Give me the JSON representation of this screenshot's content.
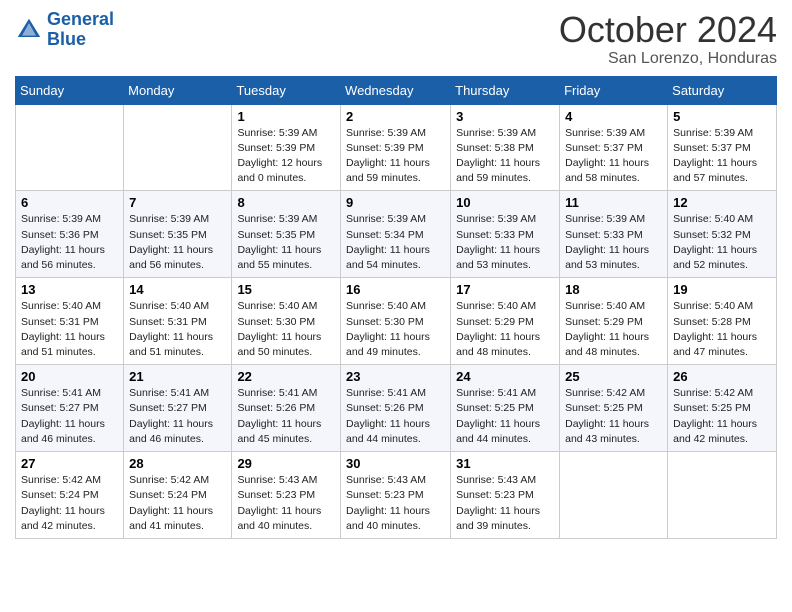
{
  "logo": {
    "line1": "General",
    "line2": "Blue"
  },
  "title": "October 2024",
  "subtitle": "San Lorenzo, Honduras",
  "days_of_week": [
    "Sunday",
    "Monday",
    "Tuesday",
    "Wednesday",
    "Thursday",
    "Friday",
    "Saturday"
  ],
  "weeks": [
    [
      {
        "day": "",
        "sunrise": "",
        "sunset": "",
        "daylight": ""
      },
      {
        "day": "",
        "sunrise": "",
        "sunset": "",
        "daylight": ""
      },
      {
        "day": "1",
        "sunrise": "Sunrise: 5:39 AM",
        "sunset": "Sunset: 5:39 PM",
        "daylight": "Daylight: 12 hours and 0 minutes."
      },
      {
        "day": "2",
        "sunrise": "Sunrise: 5:39 AM",
        "sunset": "Sunset: 5:39 PM",
        "daylight": "Daylight: 11 hours and 59 minutes."
      },
      {
        "day": "3",
        "sunrise": "Sunrise: 5:39 AM",
        "sunset": "Sunset: 5:38 PM",
        "daylight": "Daylight: 11 hours and 59 minutes."
      },
      {
        "day": "4",
        "sunrise": "Sunrise: 5:39 AM",
        "sunset": "Sunset: 5:37 PM",
        "daylight": "Daylight: 11 hours and 58 minutes."
      },
      {
        "day": "5",
        "sunrise": "Sunrise: 5:39 AM",
        "sunset": "Sunset: 5:37 PM",
        "daylight": "Daylight: 11 hours and 57 minutes."
      }
    ],
    [
      {
        "day": "6",
        "sunrise": "Sunrise: 5:39 AM",
        "sunset": "Sunset: 5:36 PM",
        "daylight": "Daylight: 11 hours and 56 minutes."
      },
      {
        "day": "7",
        "sunrise": "Sunrise: 5:39 AM",
        "sunset": "Sunset: 5:35 PM",
        "daylight": "Daylight: 11 hours and 56 minutes."
      },
      {
        "day": "8",
        "sunrise": "Sunrise: 5:39 AM",
        "sunset": "Sunset: 5:35 PM",
        "daylight": "Daylight: 11 hours and 55 minutes."
      },
      {
        "day": "9",
        "sunrise": "Sunrise: 5:39 AM",
        "sunset": "Sunset: 5:34 PM",
        "daylight": "Daylight: 11 hours and 54 minutes."
      },
      {
        "day": "10",
        "sunrise": "Sunrise: 5:39 AM",
        "sunset": "Sunset: 5:33 PM",
        "daylight": "Daylight: 11 hours and 53 minutes."
      },
      {
        "day": "11",
        "sunrise": "Sunrise: 5:39 AM",
        "sunset": "Sunset: 5:33 PM",
        "daylight": "Daylight: 11 hours and 53 minutes."
      },
      {
        "day": "12",
        "sunrise": "Sunrise: 5:40 AM",
        "sunset": "Sunset: 5:32 PM",
        "daylight": "Daylight: 11 hours and 52 minutes."
      }
    ],
    [
      {
        "day": "13",
        "sunrise": "Sunrise: 5:40 AM",
        "sunset": "Sunset: 5:31 PM",
        "daylight": "Daylight: 11 hours and 51 minutes."
      },
      {
        "day": "14",
        "sunrise": "Sunrise: 5:40 AM",
        "sunset": "Sunset: 5:31 PM",
        "daylight": "Daylight: 11 hours and 51 minutes."
      },
      {
        "day": "15",
        "sunrise": "Sunrise: 5:40 AM",
        "sunset": "Sunset: 5:30 PM",
        "daylight": "Daylight: 11 hours and 50 minutes."
      },
      {
        "day": "16",
        "sunrise": "Sunrise: 5:40 AM",
        "sunset": "Sunset: 5:30 PM",
        "daylight": "Daylight: 11 hours and 49 minutes."
      },
      {
        "day": "17",
        "sunrise": "Sunrise: 5:40 AM",
        "sunset": "Sunset: 5:29 PM",
        "daylight": "Daylight: 11 hours and 48 minutes."
      },
      {
        "day": "18",
        "sunrise": "Sunrise: 5:40 AM",
        "sunset": "Sunset: 5:29 PM",
        "daylight": "Daylight: 11 hours and 48 minutes."
      },
      {
        "day": "19",
        "sunrise": "Sunrise: 5:40 AM",
        "sunset": "Sunset: 5:28 PM",
        "daylight": "Daylight: 11 hours and 47 minutes."
      }
    ],
    [
      {
        "day": "20",
        "sunrise": "Sunrise: 5:41 AM",
        "sunset": "Sunset: 5:27 PM",
        "daylight": "Daylight: 11 hours and 46 minutes."
      },
      {
        "day": "21",
        "sunrise": "Sunrise: 5:41 AM",
        "sunset": "Sunset: 5:27 PM",
        "daylight": "Daylight: 11 hours and 46 minutes."
      },
      {
        "day": "22",
        "sunrise": "Sunrise: 5:41 AM",
        "sunset": "Sunset: 5:26 PM",
        "daylight": "Daylight: 11 hours and 45 minutes."
      },
      {
        "day": "23",
        "sunrise": "Sunrise: 5:41 AM",
        "sunset": "Sunset: 5:26 PM",
        "daylight": "Daylight: 11 hours and 44 minutes."
      },
      {
        "day": "24",
        "sunrise": "Sunrise: 5:41 AM",
        "sunset": "Sunset: 5:25 PM",
        "daylight": "Daylight: 11 hours and 44 minutes."
      },
      {
        "day": "25",
        "sunrise": "Sunrise: 5:42 AM",
        "sunset": "Sunset: 5:25 PM",
        "daylight": "Daylight: 11 hours and 43 minutes."
      },
      {
        "day": "26",
        "sunrise": "Sunrise: 5:42 AM",
        "sunset": "Sunset: 5:25 PM",
        "daylight": "Daylight: 11 hours and 42 minutes."
      }
    ],
    [
      {
        "day": "27",
        "sunrise": "Sunrise: 5:42 AM",
        "sunset": "Sunset: 5:24 PM",
        "daylight": "Daylight: 11 hours and 42 minutes."
      },
      {
        "day": "28",
        "sunrise": "Sunrise: 5:42 AM",
        "sunset": "Sunset: 5:24 PM",
        "daylight": "Daylight: 11 hours and 41 minutes."
      },
      {
        "day": "29",
        "sunrise": "Sunrise: 5:43 AM",
        "sunset": "Sunset: 5:23 PM",
        "daylight": "Daylight: 11 hours and 40 minutes."
      },
      {
        "day": "30",
        "sunrise": "Sunrise: 5:43 AM",
        "sunset": "Sunset: 5:23 PM",
        "daylight": "Daylight: 11 hours and 40 minutes."
      },
      {
        "day": "31",
        "sunrise": "Sunrise: 5:43 AM",
        "sunset": "Sunset: 5:23 PM",
        "daylight": "Daylight: 11 hours and 39 minutes."
      },
      {
        "day": "",
        "sunrise": "",
        "sunset": "",
        "daylight": ""
      },
      {
        "day": "",
        "sunrise": "",
        "sunset": "",
        "daylight": ""
      }
    ]
  ]
}
